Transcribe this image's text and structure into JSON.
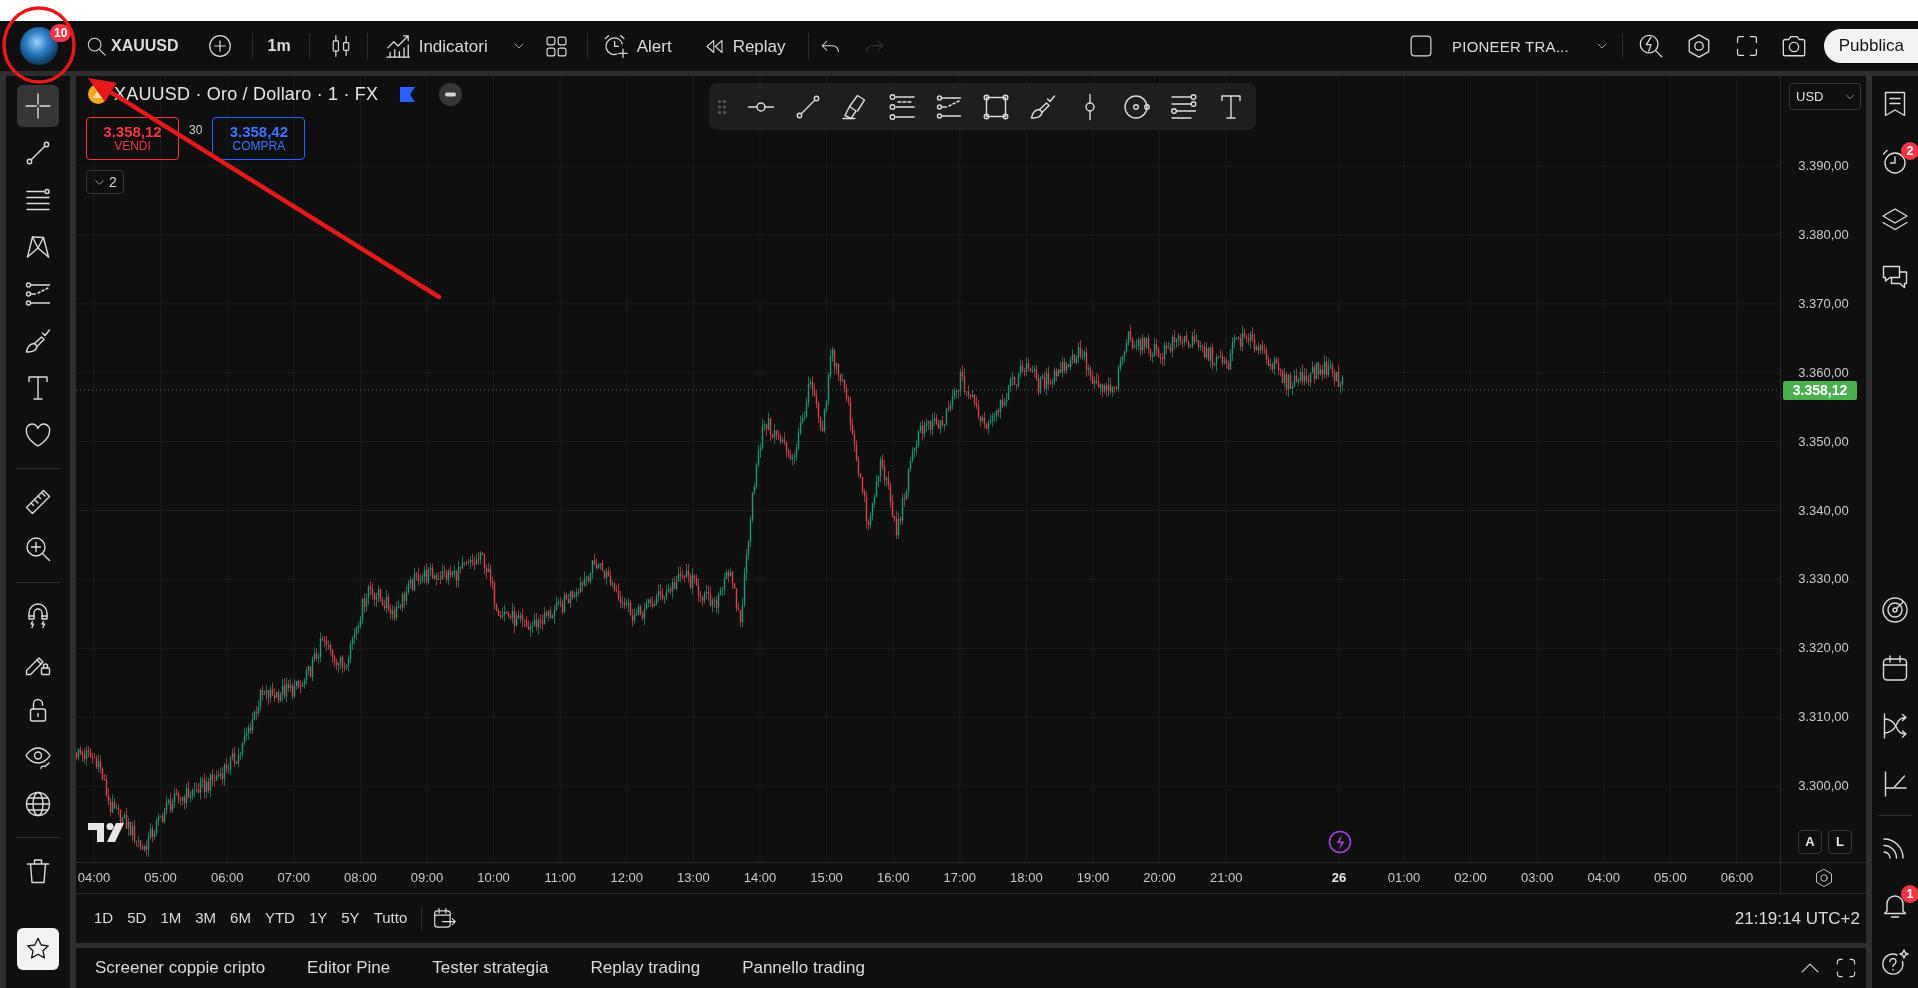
{
  "annotations": [
    {
      "kind": "circle"
    },
    {
      "kind": "arrow"
    }
  ],
  "top_bar": {
    "avatar_badge": "10",
    "symbol": "XAUUSD",
    "interval": "1m",
    "indicators": "Indicatori",
    "alert": "Alert",
    "replay": "Replay",
    "history": [
      {
        "kind": "undo",
        "disabled": false
      },
      {
        "kind": "redo",
        "disabled": true
      }
    ],
    "layout_name": "PIONEER TRA...",
    "publish": "Pubblica"
  },
  "left_toolbar": {
    "groups": [
      {
        "tools": [
          {
            "kind": "crosshair",
            "selected": true
          },
          {
            "kind": "trend-line",
            "selected": false
          },
          {
            "kind": "fib",
            "selected": false
          },
          {
            "kind": "pattern",
            "selected": false
          },
          {
            "kind": "forecast",
            "selected": false
          },
          {
            "kind": "brush",
            "selected": false
          },
          {
            "kind": "text",
            "selected": false
          },
          {
            "kind": "heart",
            "selected": false
          }
        ]
      },
      {
        "tools": [
          {
            "kind": "ruler",
            "selected": false
          },
          {
            "kind": "zoom",
            "selected": false
          }
        ]
      },
      {
        "tools": [
          {
            "kind": "magnet",
            "selected": false
          },
          {
            "kind": "pencil-lock",
            "selected": false
          },
          {
            "kind": "lock",
            "selected": false
          },
          {
            "kind": "eye",
            "selected": false
          },
          {
            "kind": "globe",
            "selected": false
          }
        ]
      },
      {
        "tools": [
          {
            "kind": "trash",
            "selected": false
          }
        ]
      }
    ],
    "star": {
      "on": true
    }
  },
  "chart": {
    "legend": {
      "title": "XAUUSD · Oro / Dollaro · 1 · FX",
      "sell": {
        "price": "3.358,12",
        "label": "VENDI"
      },
      "spread": "30",
      "buy": {
        "price": "3.358,42",
        "label": "COMPRA"
      },
      "indicator_count": "2"
    },
    "drawing_toolbar": {
      "tools": [
        {
          "kind": "horizontal-ray"
        },
        {
          "kind": "trend-line"
        },
        {
          "kind": "highlighter"
        },
        {
          "kind": "fib-lines"
        },
        {
          "kind": "forecast"
        },
        {
          "kind": "rectangle"
        },
        {
          "kind": "brush"
        },
        {
          "kind": "vertical-line"
        },
        {
          "kind": "circle"
        },
        {
          "kind": "text-lines"
        },
        {
          "kind": "text"
        }
      ]
    },
    "price_axis": {
      "currency": "USD",
      "ticks": [
        "3.390,00",
        "3.380,00",
        "3.370,00",
        "3.360,00",
        "3.350,00",
        "3.340,00",
        "3.330,00",
        "3.320,00",
        "3.310,00",
        "3.300,00"
      ],
      "last_price": "3.358,12",
      "scale_buttons": [
        "A",
        "L"
      ]
    },
    "time_axis": {
      "ticks": [
        {
          "label": "04:00",
          "kind": "hour"
        },
        {
          "label": "05:00",
          "kind": "hour"
        },
        {
          "label": "06:00",
          "kind": "hour"
        },
        {
          "label": "07:00",
          "kind": "hour"
        },
        {
          "label": "08:00",
          "kind": "hour"
        },
        {
          "label": "09:00",
          "kind": "hour"
        },
        {
          "label": "10:00",
          "kind": "hour"
        },
        {
          "label": "11:00",
          "kind": "hour"
        },
        {
          "label": "12:00",
          "kind": "hour"
        },
        {
          "label": "13:00",
          "kind": "hour"
        },
        {
          "label": "14:00",
          "kind": "hour"
        },
        {
          "label": "15:00",
          "kind": "hour"
        },
        {
          "label": "16:00",
          "kind": "hour"
        },
        {
          "label": "17:00",
          "kind": "hour"
        },
        {
          "label": "18:00",
          "kind": "hour"
        },
        {
          "label": "19:00",
          "kind": "hour"
        },
        {
          "label": "20:00",
          "kind": "hour"
        },
        {
          "label": "21:00",
          "kind": "hour"
        },
        {
          "label": "26",
          "kind": "day"
        },
        {
          "label": "01:00",
          "kind": "hour"
        },
        {
          "label": "02:00",
          "kind": "hour"
        },
        {
          "label": "03:00",
          "kind": "hour"
        },
        {
          "label": "04:00",
          "kind": "hour"
        },
        {
          "label": "05:00",
          "kind": "hour"
        },
        {
          "label": "06:00",
          "kind": "hour"
        }
      ]
    },
    "ranges": [
      "1D",
      "5D",
      "1M",
      "3M",
      "6M",
      "YTD",
      "1Y",
      "5Y",
      "Tutto"
    ],
    "clock": "21:19:14 UTC+2"
  },
  "bottom_panel": {
    "tabs": [
      {
        "label": "Screener coppie cripto",
        "selected": false
      },
      {
        "label": "Editor Pine",
        "selected": false
      },
      {
        "label": "Tester strategia",
        "selected": false
      },
      {
        "label": "Replay trading",
        "selected": false
      },
      {
        "label": "Pannello trading",
        "selected": false
      }
    ]
  },
  "right_toolbar": {
    "groups": [
      {
        "items": [
          {
            "kind": "watchlist"
          },
          {
            "kind": "alerts",
            "badge": "2"
          },
          {
            "kind": "layers"
          },
          {
            "kind": "chat"
          }
        ]
      },
      {
        "items": [
          {
            "kind": "target"
          },
          {
            "kind": "calendar"
          },
          {
            "kind": "crossing"
          },
          {
            "kind": "hotlist"
          }
        ]
      },
      {
        "items": [
          {
            "kind": "stream"
          },
          {
            "kind": "notifications",
            "badge": "1"
          },
          {
            "kind": "help"
          }
        ]
      }
    ]
  }
}
